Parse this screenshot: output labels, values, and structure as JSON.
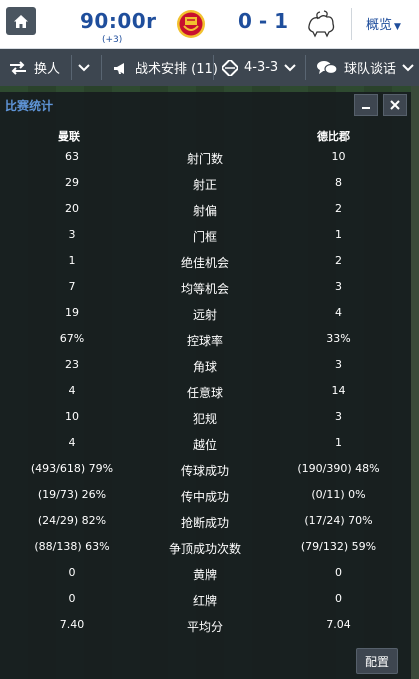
{
  "header": {
    "clock": "90:00r",
    "added_time": "(+3)",
    "score": "0 - 1",
    "overview_label": "概览",
    "home_crest": "manchester-united-crest",
    "away_crest": "derby-county-crest"
  },
  "toolbar": {
    "substitute_label": "换人",
    "tactics_label": "战术安排 (11)",
    "formation_label": "4-3-3",
    "team_talk_label": "球队谈话"
  },
  "panel": {
    "title": "比赛统计",
    "home_team": "曼联",
    "away_team": "德比郡",
    "config_label": "配置"
  },
  "stats": [
    {
      "home": "63",
      "name": "射门数",
      "away": "10"
    },
    {
      "home": "29",
      "name": "射正",
      "away": "8"
    },
    {
      "home": "20",
      "name": "射偏",
      "away": "2"
    },
    {
      "home": "3",
      "name": "门框",
      "away": "1"
    },
    {
      "home": "1",
      "name": "绝佳机会",
      "away": "2"
    },
    {
      "home": "7",
      "name": "均等机会",
      "away": "3"
    },
    {
      "home": "19",
      "name": "远射",
      "away": "4"
    },
    {
      "home": "67%",
      "name": "控球率",
      "away": "33%"
    },
    {
      "home": "23",
      "name": "角球",
      "away": "3"
    },
    {
      "home": "4",
      "name": "任意球",
      "away": "14"
    },
    {
      "home": "10",
      "name": "犯规",
      "away": "3"
    },
    {
      "home": "4",
      "name": "越位",
      "away": "1"
    },
    {
      "home": "(493/618) 79%",
      "name": "传球成功",
      "away": "(190/390) 48%"
    },
    {
      "home": "(19/73) 26%",
      "name": "传中成功",
      "away": "(0/11) 0%"
    },
    {
      "home": "(24/29) 82%",
      "name": "抢断成功",
      "away": "(17/24) 70%"
    },
    {
      "home": "(88/138) 63%",
      "name": "争顶成功次数",
      "away": "(79/132) 59%"
    },
    {
      "home": "0",
      "name": "黄牌",
      "away": "0"
    },
    {
      "home": "0",
      "name": "红牌",
      "away": "0"
    },
    {
      "home": "7.40",
      "name": "平均分",
      "away": "7.04"
    }
  ],
  "colors": {
    "accent": "#1f4e9c",
    "panel_title": "#5f95d8",
    "toolbar_bg": "#3d4650"
  }
}
